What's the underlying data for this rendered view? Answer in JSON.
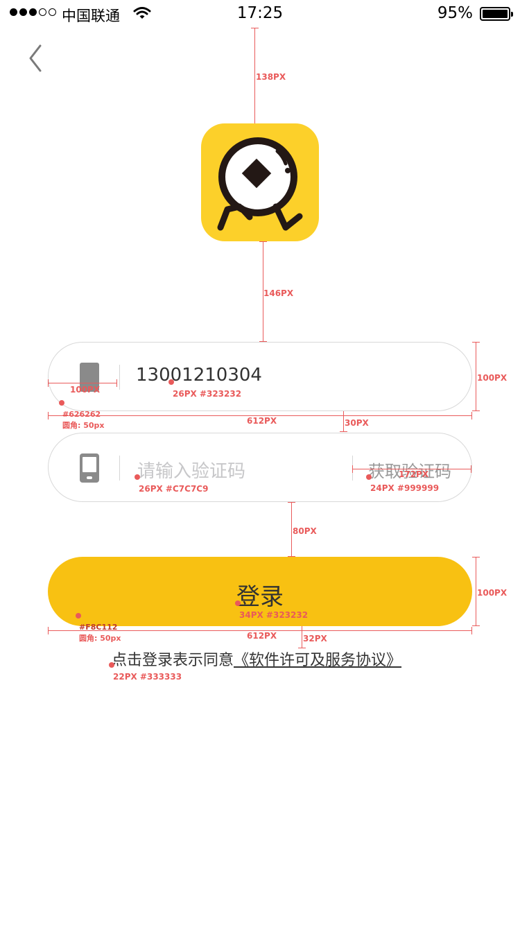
{
  "status_bar": {
    "carrier": "中国联通",
    "time": "17:25",
    "battery_percent": "95%",
    "signal_bars_filled": 3,
    "signal_bars_total": 5,
    "battery_level": 0.95
  },
  "nav": {
    "back_icon": "chevron-left-icon"
  },
  "logo": {
    "icon": "coin-runner-logo",
    "color": "#FCD02A"
  },
  "phone_field": {
    "value": "13001210304",
    "icon": "phone-icon"
  },
  "code_field": {
    "placeholder": "请输入验证码",
    "get_code_label": "获取验证码",
    "icon": "sms-phone-icon"
  },
  "login_button": {
    "label": "登录",
    "color": "#F8C112"
  },
  "agreement": {
    "prefix": "点击登录表示同意",
    "link": "《软件许可及服务协议》"
  },
  "annotations": {
    "logo_top_gap": "138PX",
    "logo_bottom_gap": "146PX",
    "field_height": "100PX",
    "icon_area_width": "100PX",
    "phone_text_spec": "26PX #323232",
    "field_border_color": "#626262",
    "field_radius": "圆角: 50px",
    "field_width": "612PX",
    "field_gap": "30PX",
    "get_code_width": "172PX",
    "placeholder_spec": "26PX #C7C7C9",
    "get_code_spec": "24PX #999999",
    "button_gap": "80PX",
    "button_height": "100PX",
    "button_text_spec": "34PX #323232",
    "button_color": "#F8C112",
    "button_radius": "圆角: 50px",
    "button_width": "612PX",
    "agree_gap": "32PX",
    "agree_spec": "22PX #333333"
  }
}
